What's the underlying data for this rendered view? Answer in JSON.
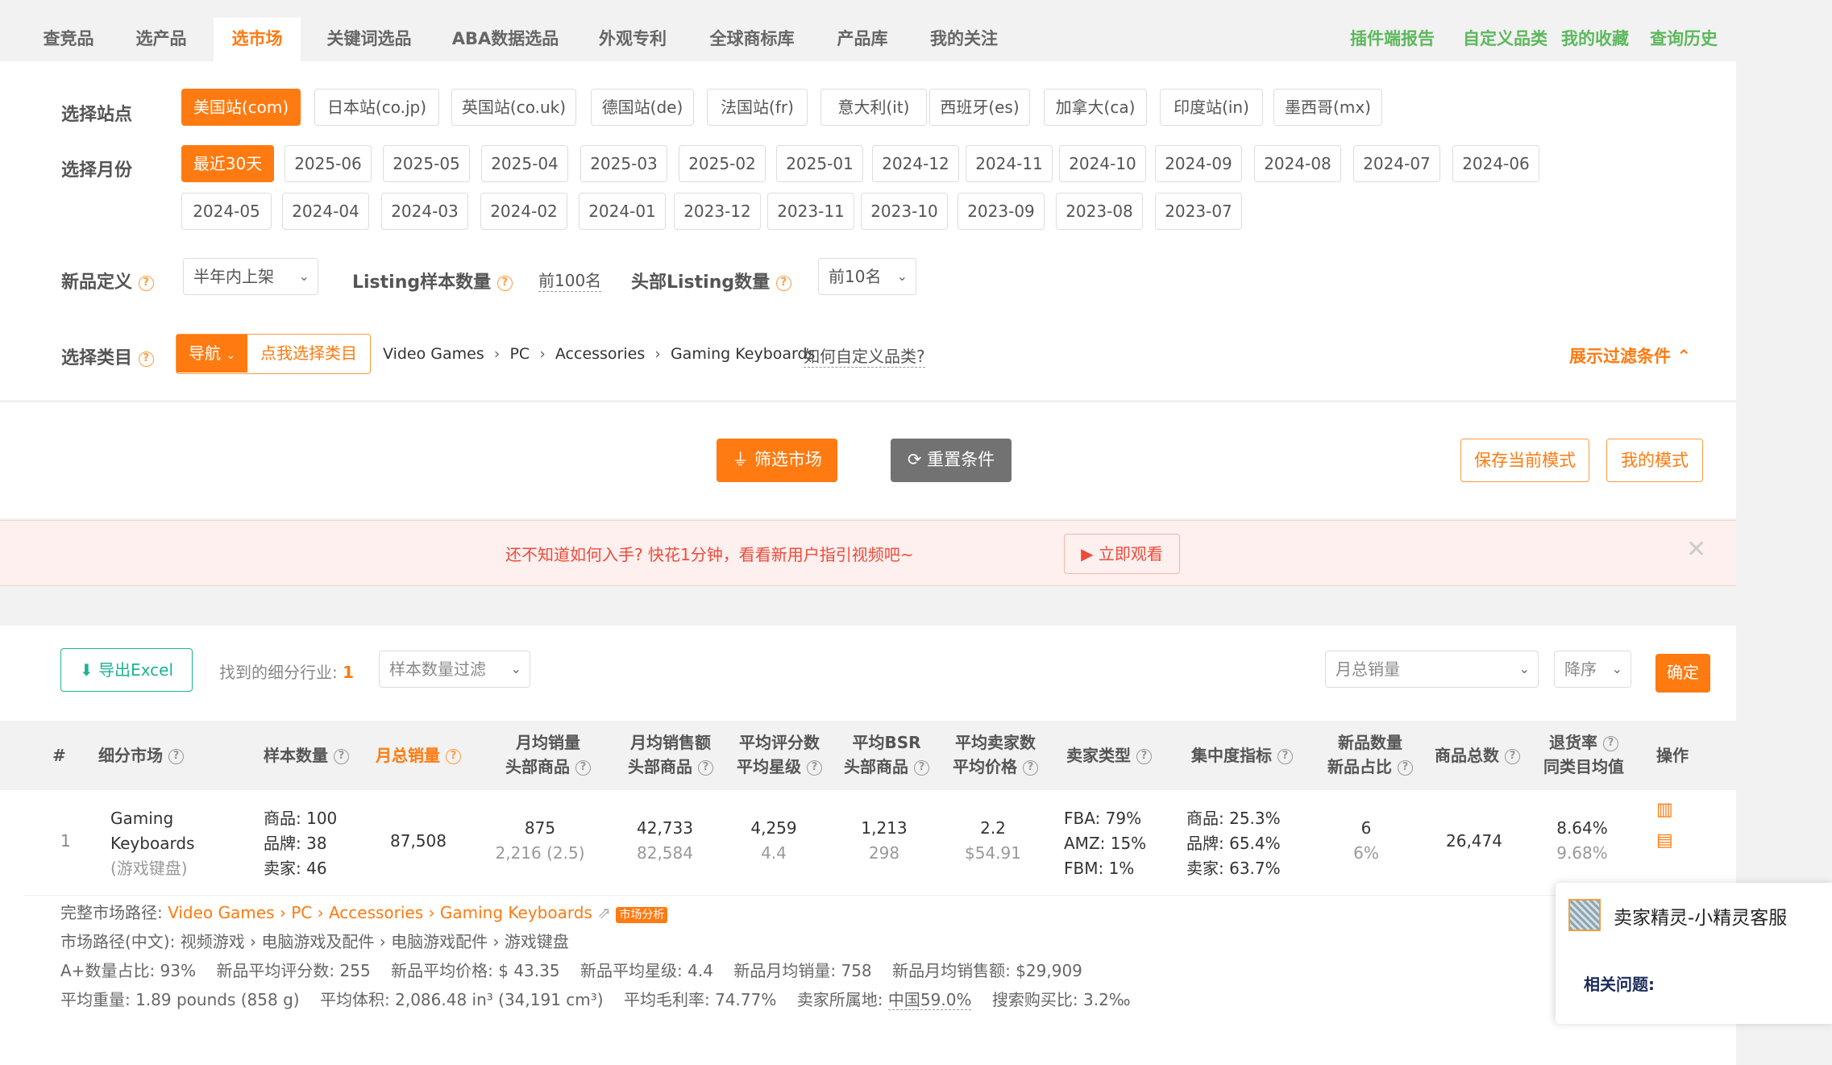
{
  "topnav": {
    "tabs": [
      "查竞品",
      "选产品",
      "选市场",
      "关键词选品",
      "ABA数据选品",
      "外观专利",
      "全球商标库",
      "产品库",
      "我的关注"
    ],
    "active_tab": "选市场",
    "right_links": [
      "插件端报告",
      "自定义品类",
      "我的收藏",
      "查询历史"
    ]
  },
  "filters": {
    "site_label": "选择站点",
    "sites": [
      "美国站(com)",
      "日本站(co.jp)",
      "英国站(co.uk)",
      "德国站(de)",
      "法国站(fr)",
      "意大利(it)",
      "西班牙(es)",
      "加拿大(ca)",
      "印度站(in)",
      "墨西哥(mx)"
    ],
    "month_label": "选择月份",
    "months_row1": [
      "最近30天",
      "2025-06",
      "2025-05",
      "2025-04",
      "2025-03",
      "2025-02",
      "2025-01",
      "2024-12",
      "2024-11",
      "2024-10",
      "2024-09",
      "2024-08",
      "2024-07",
      "2024-06"
    ],
    "months_row2": [
      "2024-05",
      "2024-04",
      "2024-03",
      "2024-02",
      "2024-01",
      "2023-12",
      "2023-11",
      "2023-10",
      "2023-09",
      "2023-08",
      "2023-07"
    ],
    "newprod_label": "新品定义",
    "newprod_value": "半年内上架",
    "listing_label": "Listing样本数量",
    "listing_value": "前100名",
    "head_label": "头部Listing数量",
    "head_value": "前10名",
    "category_label": "选择类目",
    "nav_btn": "导航",
    "choose_btn": "点我选择类目",
    "crumbs": [
      "Video Games",
      "PC",
      "Accessories",
      "Gaming Keyboards"
    ],
    "custom_link": "如何自定义品类?",
    "toggle_filter": "展示过滤条件"
  },
  "actions": {
    "filter": "筛选市场",
    "reset": "重置条件",
    "save_mode": "保存当前模式",
    "my_mode": "我的模式"
  },
  "banner": {
    "text": "还不知道如何入手? 快花1分钟，看看新用户指引视频吧~",
    "watch": "立即观看"
  },
  "toolbar": {
    "export": "导出Excel",
    "found_label": "找到的细分行业:",
    "found_count": "1",
    "sample_filter": "样本数量过滤",
    "sort_field": "月总销量",
    "sort_order": "降序",
    "confirm": "确定"
  },
  "table": {
    "headers": {
      "index": "#",
      "market": "细分市场",
      "sample": "样本数量",
      "total_sales": "月总销量",
      "avg_sales_1": "月均销量",
      "avg_sales_2": "头部商品",
      "avg_rev_1": "月均销售额",
      "avg_rev_2": "头部商品",
      "rating_1": "平均评分数",
      "rating_2": "平均星级",
      "bsr_1": "平均BSR",
      "bsr_2": "头部商品",
      "sellers_1": "平均卖家数",
      "sellers_2": "平均价格",
      "seller_type": "卖家类型",
      "concentration": "集中度指标",
      "new_1": "新品数量",
      "new_2": "新品占比",
      "total_products": "商品总数",
      "return_1": "退货率",
      "return_2": "同类目均值",
      "ops": "操作"
    },
    "row": {
      "index": "1",
      "market_en_1": "Gaming",
      "market_en_2": "Keyboards",
      "market_cn": "(游戏键盘)",
      "sample_products": "商品: 100",
      "sample_brands": "品牌: 38",
      "sample_sellers": "卖家: 46",
      "total_sales": "87,508",
      "avg_sales": "875",
      "avg_sales_head": "2,216 (2.5)",
      "avg_rev": "42,733",
      "avg_rev_head": "82,584",
      "rating_count": "4,259",
      "rating_star": "4.4",
      "bsr": "1,213",
      "bsr_head": "298",
      "sellers": "2.2",
      "price": "$54.91",
      "fba": "FBA: 79%",
      "amz": "AMZ: 15%",
      "fbm": "FBM: 1%",
      "conc_products": "商品: 25.3%",
      "conc_brands": "品牌: 65.4%",
      "conc_sellers": "卖家: 63.7%",
      "new_count": "6",
      "new_ratio": "6%",
      "total_products": "26,474",
      "return_rate": "8.64%",
      "return_avg": "9.68%"
    }
  },
  "details": {
    "path_label": "完整市场路径:",
    "path": [
      "Video Games",
      "PC",
      "Accessories",
      "Gaming Keyboards"
    ],
    "analysis_tag": "市场分析",
    "path_cn_label": "市场路径(中文):",
    "path_cn": "视频游戏 › 电脑游戏及配件 › 电脑游戏配件 › 游戏键盘",
    "line3": [
      "A+数量占比: 93%",
      "新品平均评分数: 255",
      "新品平均价格: $ 43.35",
      "新品平均星级: 4.4",
      "新品月均销量: 758",
      "新品月均销售额: $29,909"
    ],
    "weight": "平均重量: 1.89 pounds (858 g)",
    "volume": "平均体积: 2,086.48 in³ (34,191 cm³)",
    "margin": "平均毛利率: 74.77%",
    "origin_label": "卖家所属地:",
    "origin_value": "中国59.0%",
    "search_ratio": "搜索购买比: 3.2‰"
  },
  "chat": {
    "title": "卖家精灵-小精灵客服",
    "related": "相关问题:"
  },
  "colors": {
    "accent": "#ff7a10",
    "green": "#5cb85c",
    "teal": "#1cb394"
  }
}
